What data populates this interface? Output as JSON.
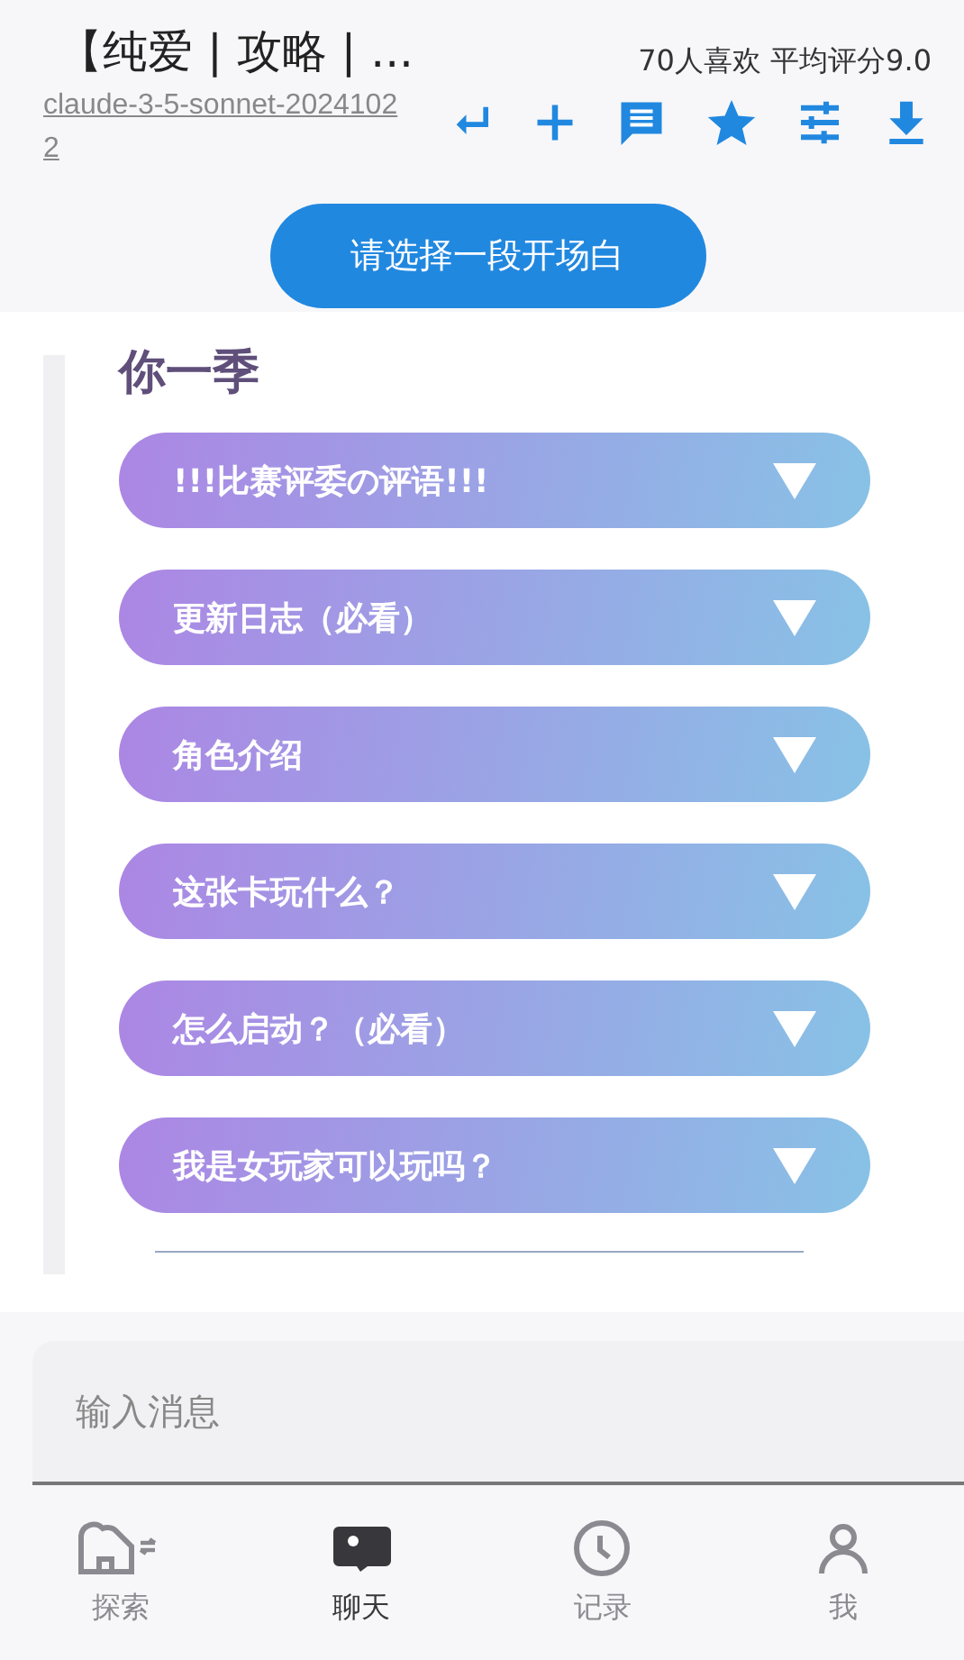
{
  "header": {
    "title": "【纯爱 | 攻略 | ...",
    "model": "claude-3-5-sonnet-20241022",
    "stats": "70人喜欢 平均评分9.0"
  },
  "opening_button": "请选择一段开场白",
  "content": {
    "heading": "你一季",
    "sections": [
      {
        "label": "!!!比赛评委の评语!!!",
        "expanded": false
      },
      {
        "label": "更新日志（必看）",
        "expanded": false
      },
      {
        "label": "角色介绍",
        "expanded": false
      },
      {
        "label": "这张卡玩什么？",
        "expanded": false
      },
      {
        "label": "怎么启动？（必看）",
        "expanded": false
      },
      {
        "label": "我是女玩家可以玩吗？",
        "expanded": false
      }
    ]
  },
  "message_input": {
    "placeholder": "输入消息"
  },
  "nav": [
    {
      "label": "探索",
      "selected": false,
      "kind": "explore"
    },
    {
      "label": "聊天",
      "selected": true,
      "kind": "chat"
    },
    {
      "label": "记录",
      "selected": false,
      "kind": "history"
    },
    {
      "label": "我",
      "selected": false,
      "kind": "me"
    }
  ]
}
